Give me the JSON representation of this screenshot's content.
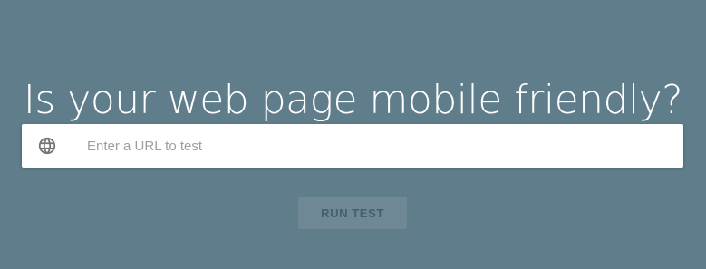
{
  "hero": {
    "headline": "Is your web page mobile friendly?"
  },
  "search": {
    "icon": "globe-icon",
    "placeholder": "Enter a URL to test",
    "value": ""
  },
  "actions": {
    "run_test_label": "RUN TEST",
    "run_test_enabled": false
  },
  "colors": {
    "background": "#607d8b",
    "headline_text": "#ffffff",
    "input_background": "#ffffff",
    "placeholder_text": "#9e9e9e",
    "button_background": "#6f8896",
    "button_text": "#4a5e69"
  }
}
